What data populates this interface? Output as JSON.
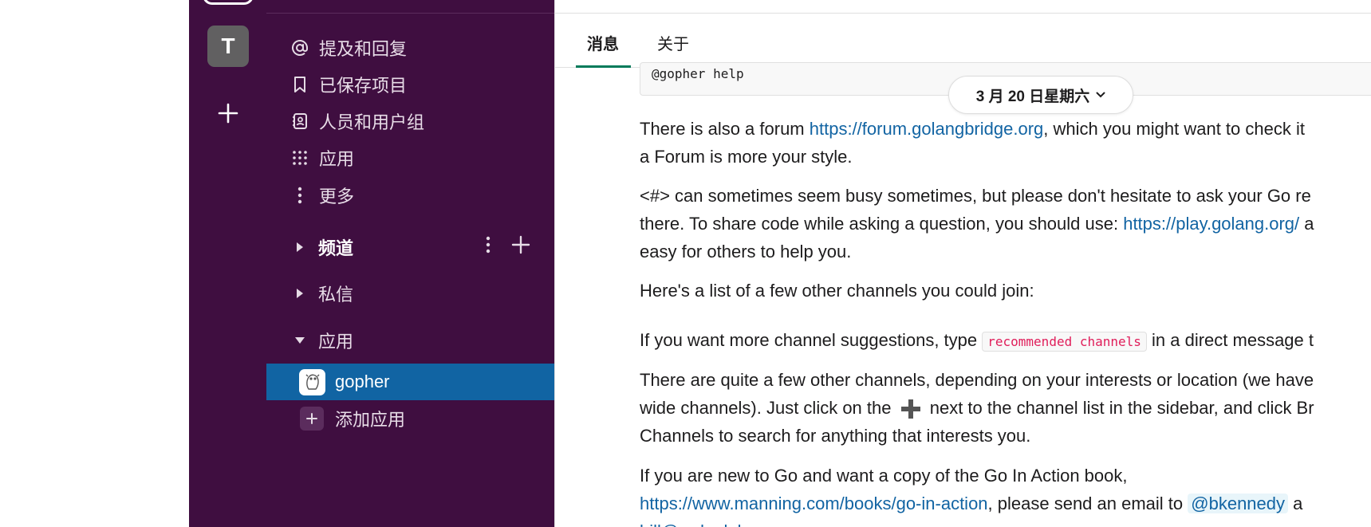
{
  "workspace": {
    "initial": "T"
  },
  "sidebar": {
    "nav": [
      {
        "label": "提及和回复",
        "icon": "at-icon"
      },
      {
        "label": "已保存项目",
        "icon": "bookmark-icon"
      },
      {
        "label": "人员和用户组",
        "icon": "contacts-icon"
      },
      {
        "label": "应用",
        "icon": "apps-grid-icon"
      },
      {
        "label": "更多",
        "icon": "more-vertical-icon"
      }
    ],
    "sections": {
      "channels": "频道",
      "dms": "私信",
      "apps": "应用"
    },
    "active_app": "gopher",
    "add_app": "添加应用"
  },
  "main": {
    "tabs": [
      "消息",
      "关于"
    ],
    "code_snippet": "@gopher help",
    "date_pill": "3 月 20 日星期六",
    "messages": {
      "forum_1": "There is also a forum ",
      "forum_link": "https://forum.golangbridge.org",
      "forum_2": ", which you might want to check it",
      "forum_3": "a Forum is more your style.",
      "busy_1": "<#> can sometimes seem busy sometimes, but please don't hesitate to ask your Go re",
      "busy_2": "there. To share code while asking a question, you should use: ",
      "busy_link": "https://play.golang.org/",
      "busy_3": " a",
      "busy_4": "easy for others to help you.",
      "list_intro": "Here's a list of a few other channels you could join:",
      "suggest_1": "If you want more channel suggestions, type ",
      "suggest_code": "recommended channels",
      "suggest_2": " in a direct message t",
      "channels_1": "There are quite a few other channels, depending on your interests or location (we have",
      "channels_2a": "wide channels). Just click on the ",
      "channels_2b": " next to the channel list in the sidebar, and click Br",
      "channels_3": "Channels to search for anything that interests you.",
      "book_1": "If you are new to Go and want a copy of the Go In Action book,",
      "book_link": "https://www.manning.com/books/go-in-action",
      "book_2": ", please send an email to ",
      "book_mention": "@bkennedy",
      "book_3": " a",
      "book_cut": "bill@ardanlabs.com"
    }
  }
}
